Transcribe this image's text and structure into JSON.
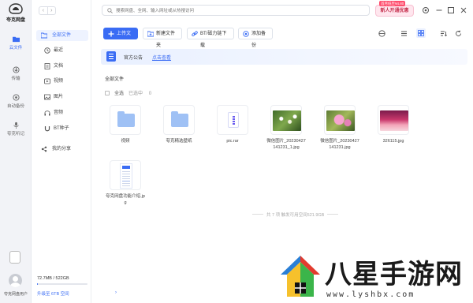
{
  "rail": {
    "brand": "夸克网盘",
    "items": [
      {
        "label": "云文件",
        "icon": "folder-icon",
        "active": true
      },
      {
        "label": "传输",
        "icon": "transfer-icon",
        "active": false
      },
      {
        "label": "自动备份",
        "icon": "backup-icon",
        "active": false
      },
      {
        "label": "夸克听记",
        "icon": "mic-icon",
        "active": false
      }
    ],
    "user": "夸克网盘用户"
  },
  "sidebar": {
    "nav_back": "‹",
    "nav_forward": "›",
    "all_files": "全部文件",
    "sub_items": [
      "最近",
      "文档",
      "视频",
      "图片",
      "音频",
      "BT种子"
    ],
    "my_share": "我的分享",
    "storage": "72.7MB / 522GB",
    "storage_used_fraction": 0.0001,
    "upgrade": "升级至 6TB 空间",
    "upgrade_arrow": "›"
  },
  "topbar": {
    "search_placeholder": "搜索网盘、全网、输入网址或从热搜访问",
    "vip_tag": "首月低至¥4.80",
    "vip_label": "新人开通优惠"
  },
  "toolbar": {
    "upload": "上传文件",
    "new_folder": "新建文件夹",
    "bt_download": "BT/磁力链下载",
    "add_backup": "添加备份"
  },
  "notice": {
    "label": "官方公告",
    "link": "点击查看"
  },
  "breadcrumb": "全部文件",
  "selection": {
    "select_all": "全选",
    "selected": "已选中",
    "count": "0"
  },
  "files": [
    {
      "name": "视频",
      "kind": "folder"
    },
    {
      "name": "夸克精选壁纸",
      "kind": "folder"
    },
    {
      "name": "pic.rar",
      "kind": "rar"
    },
    {
      "name": "微信图片_20230427141231_jpg",
      "kind": "photo-flowers1"
    },
    {
      "name": "微信图片_20230427141231.jpg",
      "kind": "photo-flowers2"
    },
    {
      "name": "326115.jpg",
      "kind": "photo-sunset"
    },
    {
      "name": "夸克网盘功能介绍.jpg",
      "kind": "doc-image"
    }
  ],
  "files_display": {
    "f3": "微信图片_20230427\n141231_1.jpg",
    "f4": "微信图片_20230427\n141231.jpg",
    "f6": "夸克网盘功能介绍.jp\ng"
  },
  "footer": "共 7 项 触发可用空间521.9GB",
  "watermark": {
    "text": "八星手游网",
    "url": "www.lyshbx.com"
  },
  "colors": {
    "accent": "#3a6cf4",
    "rail_bg": "#f2f3f7",
    "vip": "#c6304e"
  }
}
